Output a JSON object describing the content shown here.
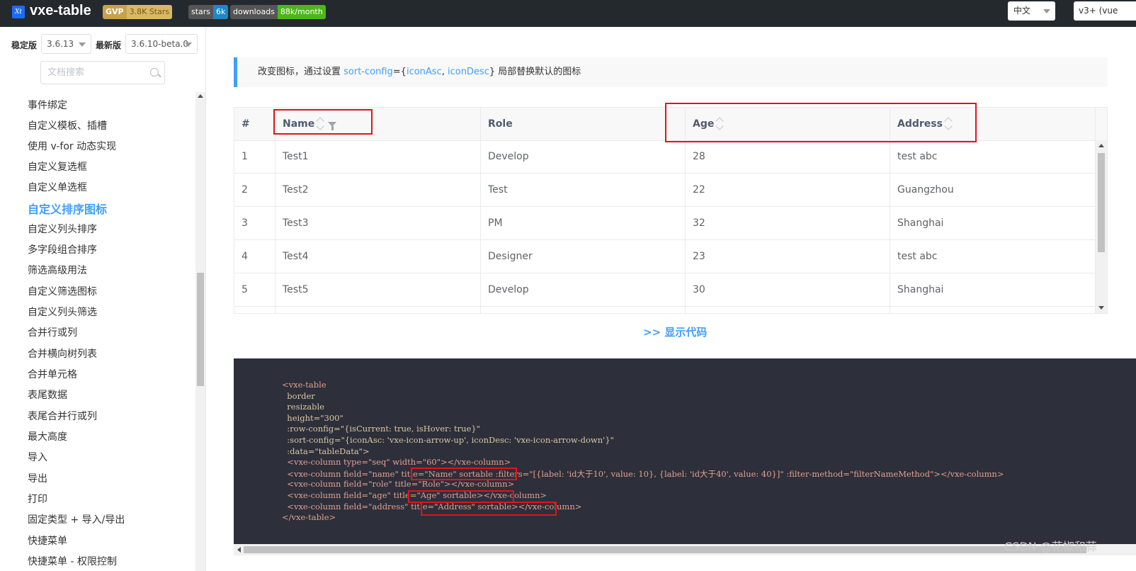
{
  "header": {
    "logo_icon": "Xt",
    "title": "vxe-table",
    "badge_gvp_label": "GVP",
    "badge_gvp_value": "3.8K Stars",
    "badge_stars_label": "stars",
    "badge_stars_value": "6k",
    "badge_downloads_label": "downloads",
    "badge_downloads_value": "88k/month",
    "language": "中文",
    "vue_version": "v3+ (vue"
  },
  "sidebar": {
    "stable_label": "稳定版",
    "stable_version": "3.6.13",
    "latest_label": "最新版",
    "latest_version": "3.6.10-beta.0",
    "search_placeholder": "文档搜索",
    "items": [
      "事件绑定",
      "自定义模板、插槽",
      "使用 v-for 动态实现",
      "自定义复选框",
      "自定义单选框",
      "自定义排序图标",
      "自定义列头排序",
      "多字段组合排序",
      "筛选高级用法",
      "自定义筛选图标",
      "自定义列头筛选",
      "合并行或列",
      "合并横向树列表",
      "合并单元格",
      "表尾数据",
      "表尾合并行或列",
      "最大高度",
      "导入",
      "导出",
      "打印",
      "固定类型 + 导入/导出",
      "快捷菜单",
      "快捷菜单 - 权限控制"
    ],
    "active_index": 5
  },
  "tip": {
    "prefix": "改变图标，通过设置 ",
    "sort_config": "sort-config",
    "mid1": "={",
    "icon_asc": "iconAsc",
    "mid2": ", ",
    "icon_desc": "iconDesc",
    "suffix": "} 局部替换默认的图标"
  },
  "table": {
    "headers": [
      "#",
      "Name",
      "Role",
      "Age",
      "Address"
    ],
    "rows": [
      [
        "1",
        "Test1",
        "Develop",
        "28",
        "test abc"
      ],
      [
        "2",
        "Test2",
        "Test",
        "22",
        "Guangzhou"
      ],
      [
        "3",
        "Test3",
        "PM",
        "32",
        "Shanghai"
      ],
      [
        "4",
        "Test4",
        "Designer",
        "23",
        "test abc"
      ],
      [
        "5",
        "Test5",
        "Develop",
        "30",
        "Shanghai"
      ]
    ]
  },
  "show_code": ">> 显示代码",
  "code_lines": [
    "<vxe-table",
    "  border",
    "  resizable",
    "  height=\"300\"",
    "  :row-config=\"{isCurrent: true, isHover: true}\"",
    "  :sort-config=\"{iconAsc: 'vxe-icon-arrow-up', iconDesc: 'vxe-icon-arrow-down'}\"",
    "  :data=\"tableData\">",
    "  <vxe-column type=\"seq\" width=\"60\"></vxe-column>",
    "  <vxe-column field=\"name\" title=\"Name\" sortable :filters=\"[{label: 'id大于10', value: 10}, {label: 'id大于40', value: 40}]\" :filter-method=\"filterNameMethod\"></vxe-column>",
    "  <vxe-column field=\"role\" title=\"Role\"></vxe-column>",
    "  <vxe-column field=\"age\" title=\"Age\" sortable></vxe-column>",
    "  <vxe-column field=\"address\" title=\"Address\" sortable></vxe-column>",
    "</vxe-table>"
  ],
  "watermark": "CSDN @花椒和蒜"
}
